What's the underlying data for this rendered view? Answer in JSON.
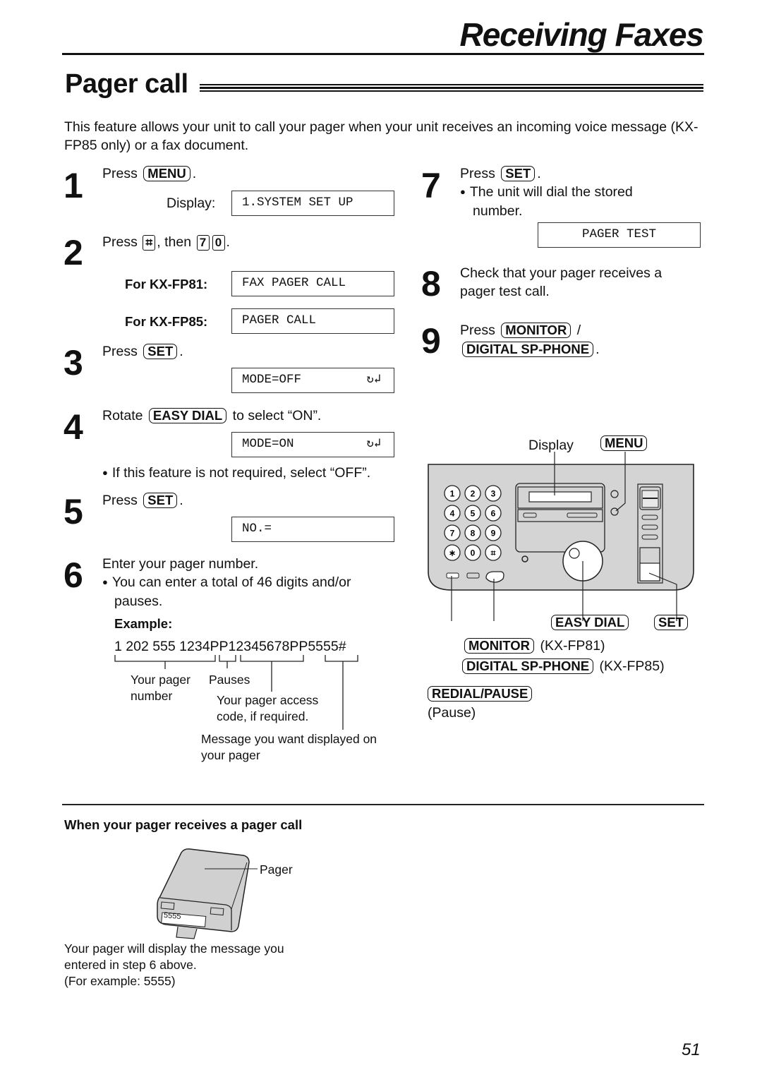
{
  "header": {
    "section_title": "Receiving Faxes",
    "page_title": "Pager call"
  },
  "intro": "This feature allows your unit to call your pager when your unit receives an incoming voice message (KX-FP85 only) or a fax document.",
  "steps": {
    "s1": {
      "num": "1",
      "press": "Press",
      "key": "MENU",
      "dot": ".",
      "display_label": "Display:",
      "display": "1.SYSTEM SET UP"
    },
    "s2": {
      "num": "2",
      "press": "Press",
      "key_hash": "⌗",
      "then": ", then",
      "key_7": "7",
      "key_0": "0",
      "dot": ".",
      "fp81_label": "For KX-FP81:",
      "fp81_display": "FAX PAGER CALL",
      "fp85_label": "For KX-FP85:",
      "fp85_display": "PAGER CALL"
    },
    "s3": {
      "num": "3",
      "press": "Press",
      "key": "SET",
      "dot": ".",
      "display": "MODE=OFF",
      "arrows": "↻↲"
    },
    "s4": {
      "num": "4",
      "rotate": "Rotate",
      "key": "EASY DIAL",
      "to_select": "to select “ON”.",
      "display": "MODE=ON",
      "arrows": "↻↲",
      "note": "If this feature is not required, select “OFF”."
    },
    "s5": {
      "num": "5",
      "press": "Press",
      "key": "SET",
      "dot": ".",
      "display": "NO.="
    },
    "s6": {
      "num": "6",
      "text": "Enter your pager number.",
      "note_line1": "You can enter a total of 46 digits and/or",
      "note_line2": "pauses.",
      "example_label": "Example:",
      "example": "1 202 555 1234PP12345678PP5555#",
      "labels": {
        "pager_number_1": "Your pager",
        "pager_number_2": "number",
        "pauses": "Pauses",
        "access_1": "Your pager access",
        "access_2": "code, if required.",
        "message_1": "Message you want displayed on",
        "message_2": "your pager"
      }
    },
    "s7": {
      "num": "7",
      "press": "Press",
      "key": "SET",
      "dot": ".",
      "note_line1": "The unit will dial the stored",
      "note_line2": "number.",
      "display": "PAGER TEST"
    },
    "s8": {
      "num": "8",
      "line1": "Check that your pager receives a",
      "line2": "pager test call."
    },
    "s9": {
      "num": "9",
      "press": "Press",
      "key1": "MONITOR",
      "slash": "/",
      "key2": "DIGITAL SP-PHONE",
      "dot": "."
    }
  },
  "fax_panel": {
    "display_label": "Display",
    "menu_key": "MENU",
    "keypad": [
      "1",
      "2",
      "3",
      "4",
      "5",
      "6",
      "7",
      "8",
      "9",
      "∗",
      "0",
      "⌗"
    ],
    "easy_dial_key": "EASY DIAL",
    "set_key": "SET",
    "monitor_key": "MONITOR",
    "monitor_model": "(KX-FP81)",
    "digital_key": "DIGITAL SP-PHONE",
    "digital_model": "(KX-FP85)",
    "redial_key": "REDIAL/PAUSE",
    "pause_label": "(Pause)",
    "panel_color": "#d4d4d4"
  },
  "pager_section": {
    "heading": "When your pager receives a pager call",
    "pager_label": "Pager",
    "pager_display": "5555",
    "caption_1": "Your pager will display the message you",
    "caption_2": "entered in step 6 above.",
    "caption_3": "(For example: 5555)"
  },
  "footer": {
    "page_number": "51"
  }
}
